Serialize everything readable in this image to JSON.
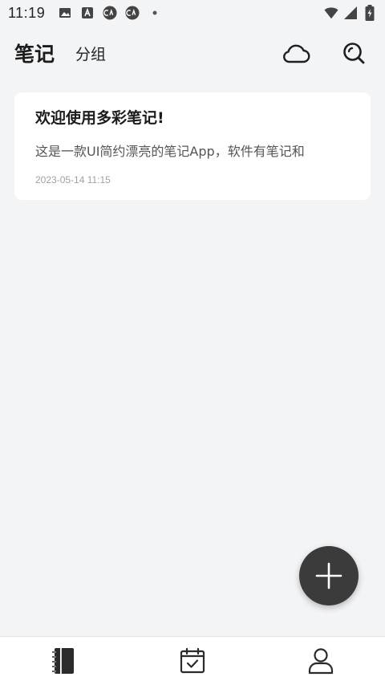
{
  "status_bar": {
    "time": "11:19",
    "left_icons": [
      "image-icon",
      "text-a-icon",
      "app-notification-icon",
      "app-notification-icon",
      "dot-icon"
    ],
    "right_icons": [
      "wifi-icon",
      "signal-icon",
      "battery-charging-icon"
    ]
  },
  "header": {
    "title": "笔记",
    "group_tab": "分组",
    "actions": [
      "cloud-icon",
      "search-icon"
    ]
  },
  "notes": [
    {
      "title": "欢迎使用多彩笔记!",
      "preview": "这是一款UI简约漂亮的笔记App，软件有笔记和",
      "date": "2023-05-14 11:15"
    }
  ],
  "fab": {
    "icon": "plus-icon",
    "color": "#3b3b3b"
  },
  "bottom_nav": {
    "items": [
      "notebook-icon",
      "calendar-check-icon",
      "user-icon"
    ]
  },
  "colors": {
    "background": "#f3f4f6",
    "card": "#ffffff",
    "text_primary": "#1c1c1c",
    "text_secondary": "#555555",
    "text_muted": "#a0a0a0"
  }
}
